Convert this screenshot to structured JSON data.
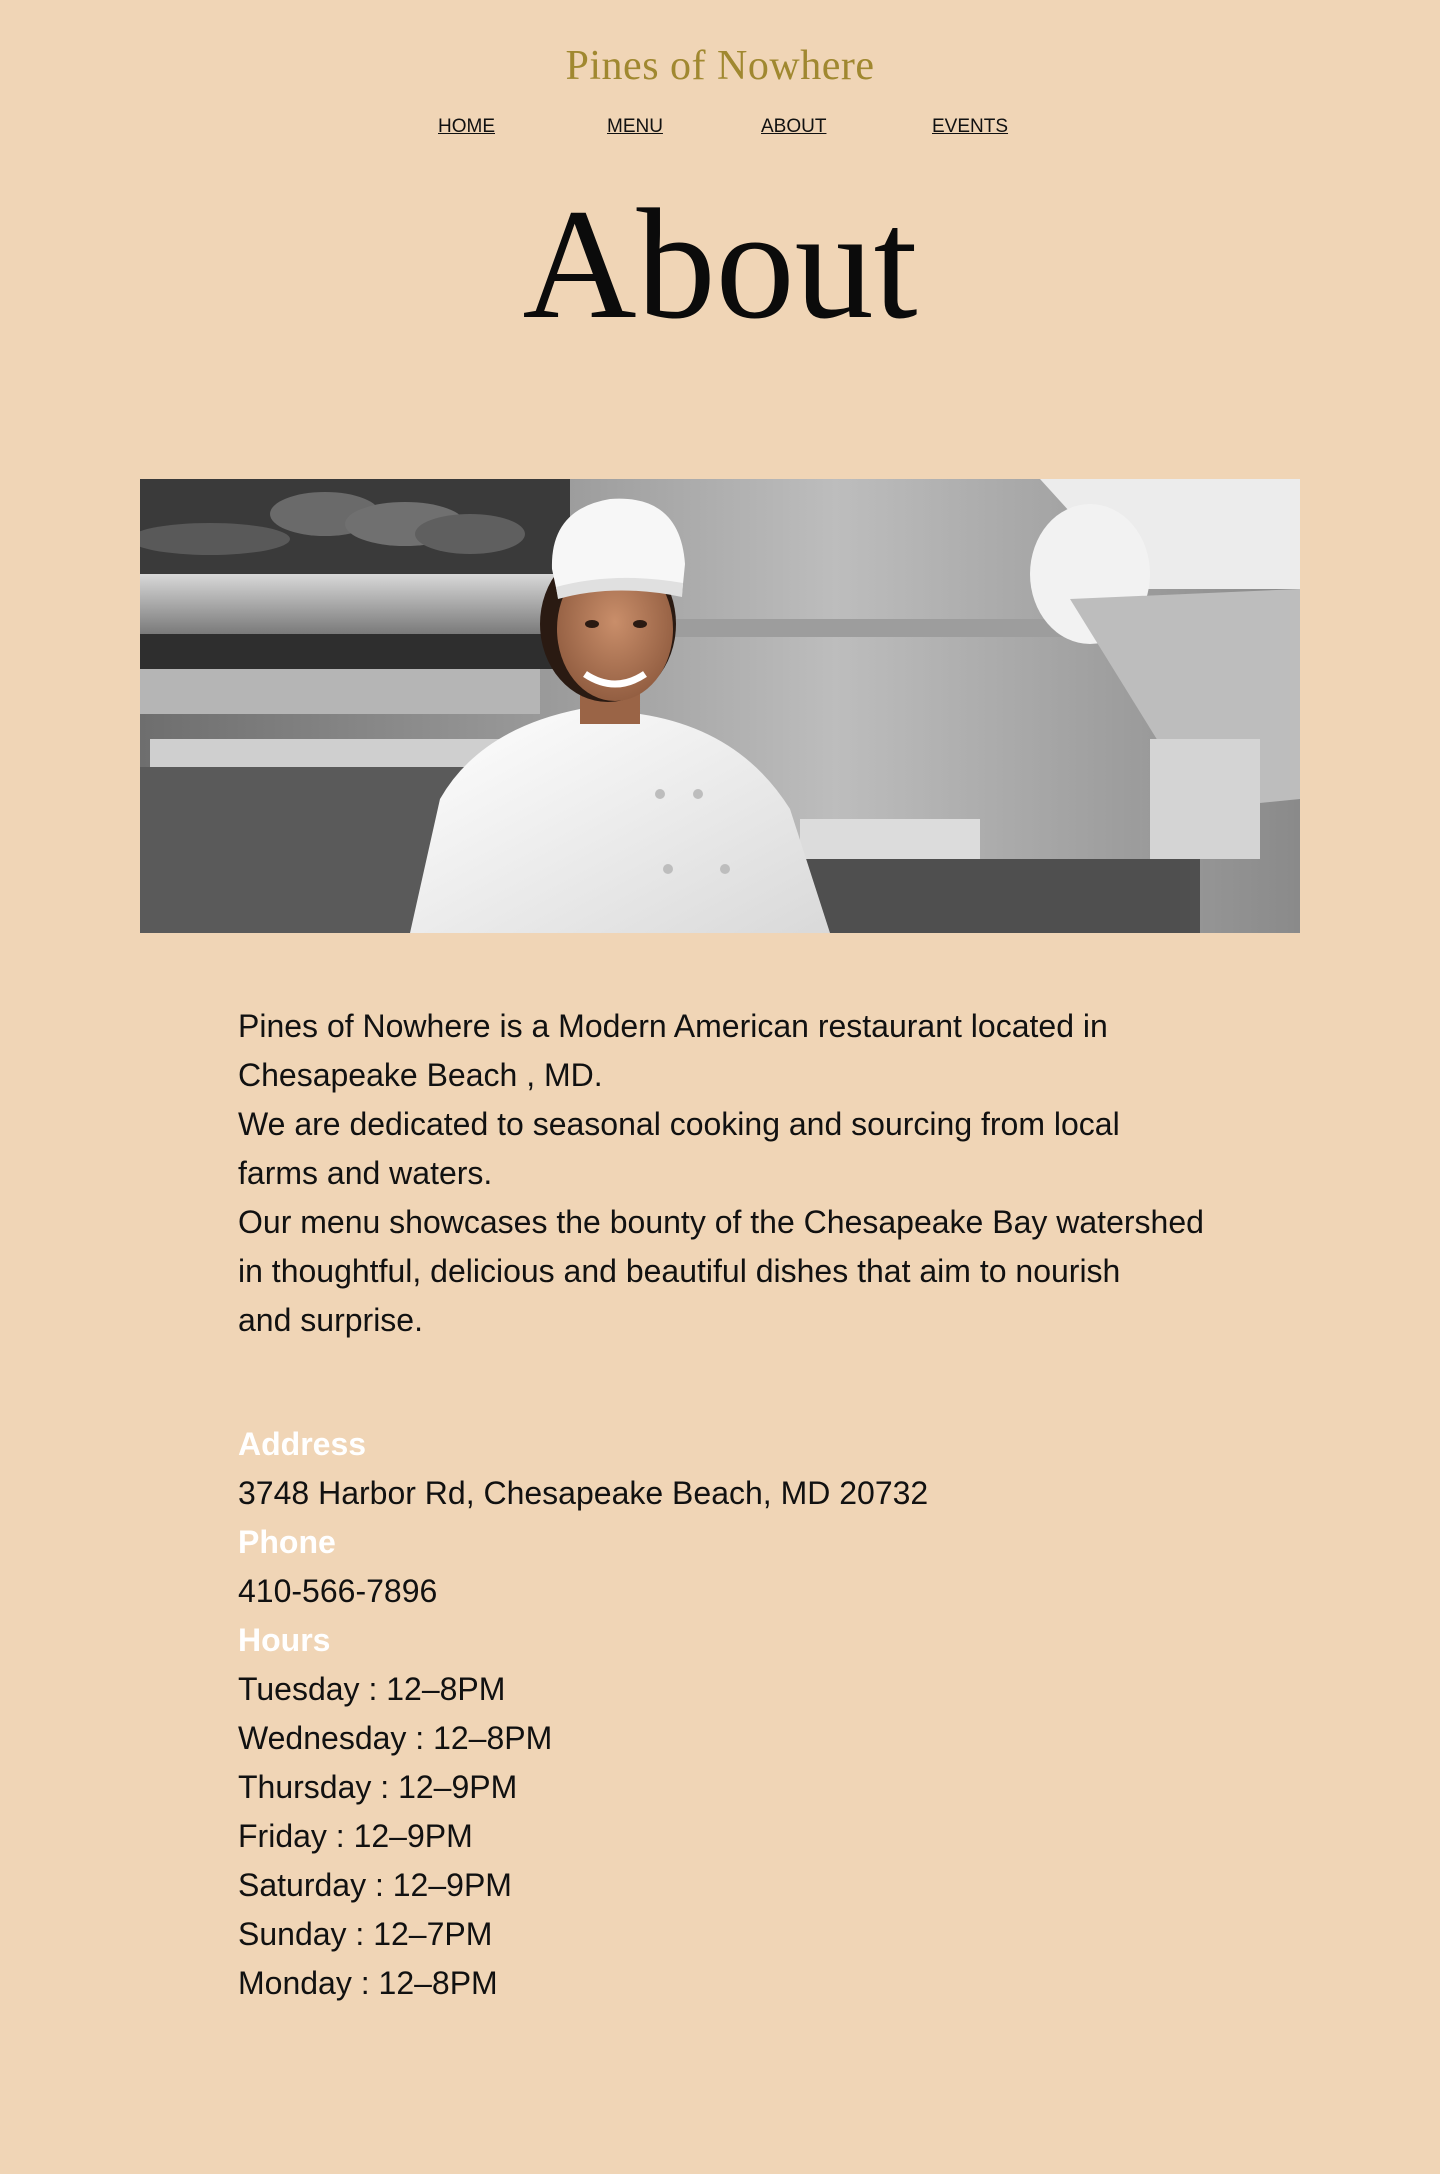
{
  "site": {
    "title": "Pines of Nowhere"
  },
  "nav": {
    "items": [
      {
        "label": "HOME"
      },
      {
        "label": "MENU"
      },
      {
        "label": "ABOUT"
      },
      {
        "label": "EVENTS"
      }
    ]
  },
  "page": {
    "heading": "About"
  },
  "hero": {
    "subject": "chef-photo"
  },
  "intro": {
    "lines": [
      "Pines of Nowhere is a Modern American restaurant located in",
      "Chesapeake Beach , MD.",
      "We are dedicated to seasonal cooking and sourcing from local",
      "farms and waters.",
      "Our menu showcases the bounty of the Chesapeake Bay watershed",
      "in thoughtful, delicious and beautiful dishes that aim to nourish",
      "and surprise."
    ]
  },
  "contact": {
    "address_label": "Address",
    "address": "3748 Harbor Rd, Chesapeake Beach, MD 20732",
    "phone_label": "Phone",
    "phone": "410-566-7896",
    "hours_label": "Hours",
    "hours": [
      "Tuesday : 12–8PM",
      "Wednesday :  12–8PM",
      "Thursday :  12–9PM",
      "Friday : 12–9PM",
      "Saturday : 12–9PM",
      "Sunday : 12–7PM",
      "Monday : 12–8PM"
    ]
  },
  "colors": {
    "background": "#f0d5b6",
    "title": "#a08830",
    "label": "#ffffff",
    "text": "#111111"
  }
}
